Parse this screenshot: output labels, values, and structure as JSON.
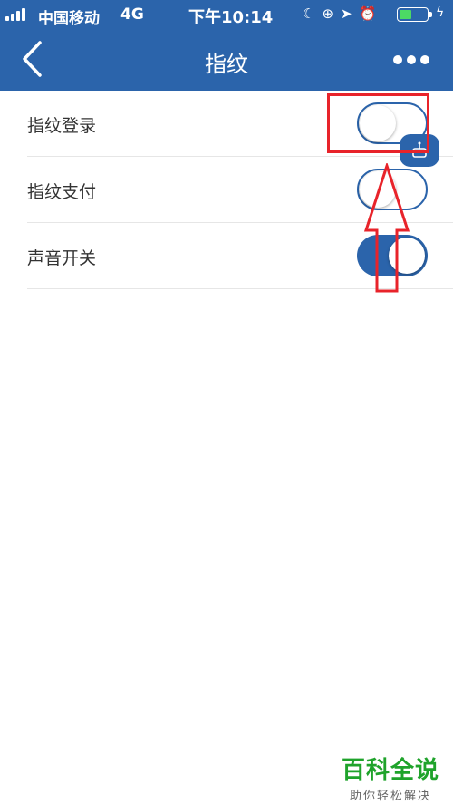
{
  "status_bar": {
    "carrier": "中国移动",
    "network": "4G",
    "time": "下午10:14",
    "battery_level": 0.45
  },
  "nav": {
    "title": "指纹",
    "back_icon": "chevron-left-icon",
    "more_icon": "more-dots-icon"
  },
  "settings": [
    {
      "label": "指纹登录",
      "enabled": false
    },
    {
      "label": "指纹支付",
      "enabled": false
    },
    {
      "label": "声音开关",
      "enabled": true
    }
  ],
  "colors": {
    "brand": "#2b64ab",
    "annotation": "#e8232a",
    "watermark": "#1fa32b"
  },
  "watermark": {
    "title": "百科全说",
    "subtitle": "助你轻松解决"
  }
}
